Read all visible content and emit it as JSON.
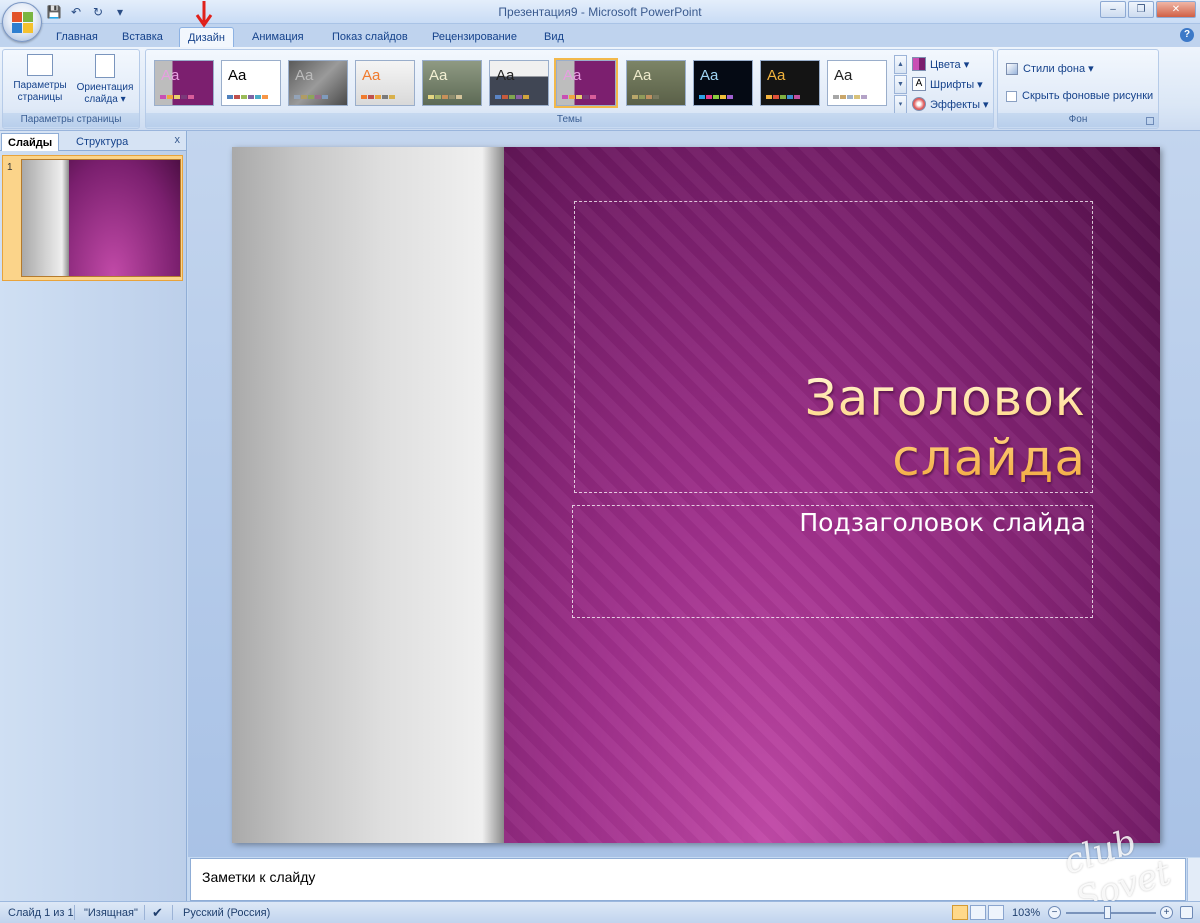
{
  "window": {
    "title": "Презентация9 - Microsoft PowerPoint",
    "controls": [
      "–",
      "❐",
      "✕"
    ]
  },
  "ribbon_tabs": [
    "Главная",
    "Вставка",
    "Дизайн",
    "Анимация",
    "Показ слайдов",
    "Рецензирование",
    "Вид"
  ],
  "active_tab": "Дизайн",
  "page_setup_group": {
    "label": "Параметры страницы",
    "page_setup_button": "Параметры страницы",
    "orientation_button": "Ориентация слайда ▾"
  },
  "themes_group": {
    "label": "Темы",
    "theme_sample": "Aa",
    "colors": "Цвета ▾",
    "fonts": "Шрифты ▾",
    "effects": "Эффекты ▾"
  },
  "background_group": {
    "label": "Фон",
    "styles": "Стили фона ▾",
    "hide_graphics": "Скрыть фоновые рисунки"
  },
  "left_pane": {
    "tabs": [
      "Слайды",
      "Структура"
    ],
    "close": "x",
    "slide_number": "1"
  },
  "slide": {
    "title": "Заголовок слайда",
    "title_line1": "Заголовок",
    "title_line2": "слайда",
    "subtitle": "Подзаголовок слайда"
  },
  "notes": {
    "placeholder": "Заметки к слайду"
  },
  "statusbar": {
    "slide_info": "Слайд 1 из 1",
    "theme_name": "\"Изящная\"",
    "language": "Русский (Россия)",
    "zoom": "103%"
  },
  "watermark": "club Sovet",
  "colors": {
    "slide_purple": "#7a1f6e",
    "title_gold": "#f2a73b",
    "selected_theme": "#f2b84b"
  }
}
